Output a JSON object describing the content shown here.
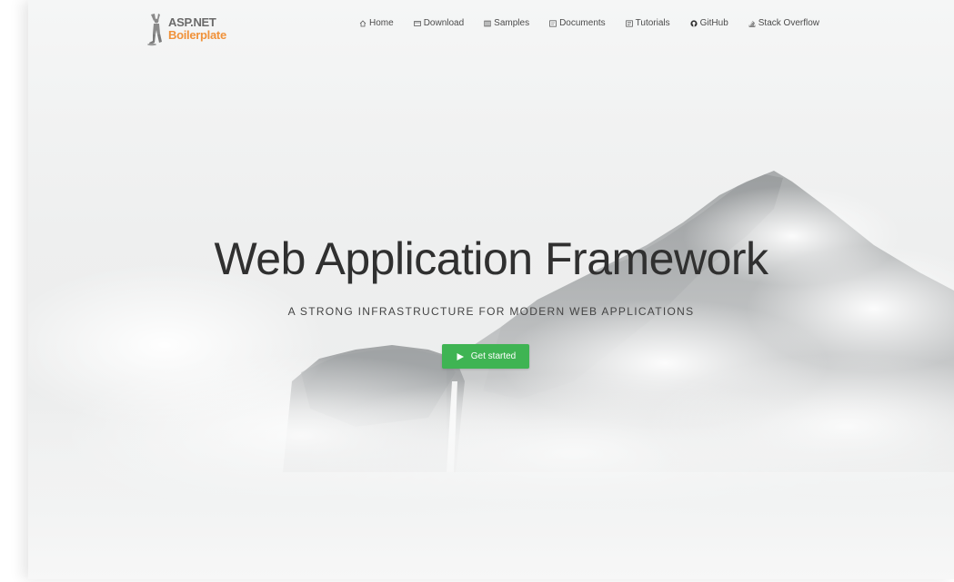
{
  "brand": {
    "line1": "ASP.NET",
    "line2": "Boilerplate",
    "accent_color": "#f0923a",
    "gray_color": "#6a6a6a"
  },
  "nav": {
    "items": [
      {
        "label": "Home",
        "icon": "home-icon"
      },
      {
        "label": "Download",
        "icon": "download-icon"
      },
      {
        "label": "Samples",
        "icon": "samples-icon"
      },
      {
        "label": "Documents",
        "icon": "documents-icon"
      },
      {
        "label": "Tutorials",
        "icon": "tutorials-icon"
      },
      {
        "label": "GitHub",
        "icon": "github-icon"
      },
      {
        "label": "Stack Overflow",
        "icon": "stack-overflow-icon"
      }
    ]
  },
  "hero": {
    "title": "Web Application Framework",
    "subtitle": "A STRONG INFRASTRUCTURE FOR MODERN WEB APPLICATIONS",
    "cta_label": "Get started",
    "cta_icon": "play-icon",
    "cta_color": "#3fb453"
  }
}
